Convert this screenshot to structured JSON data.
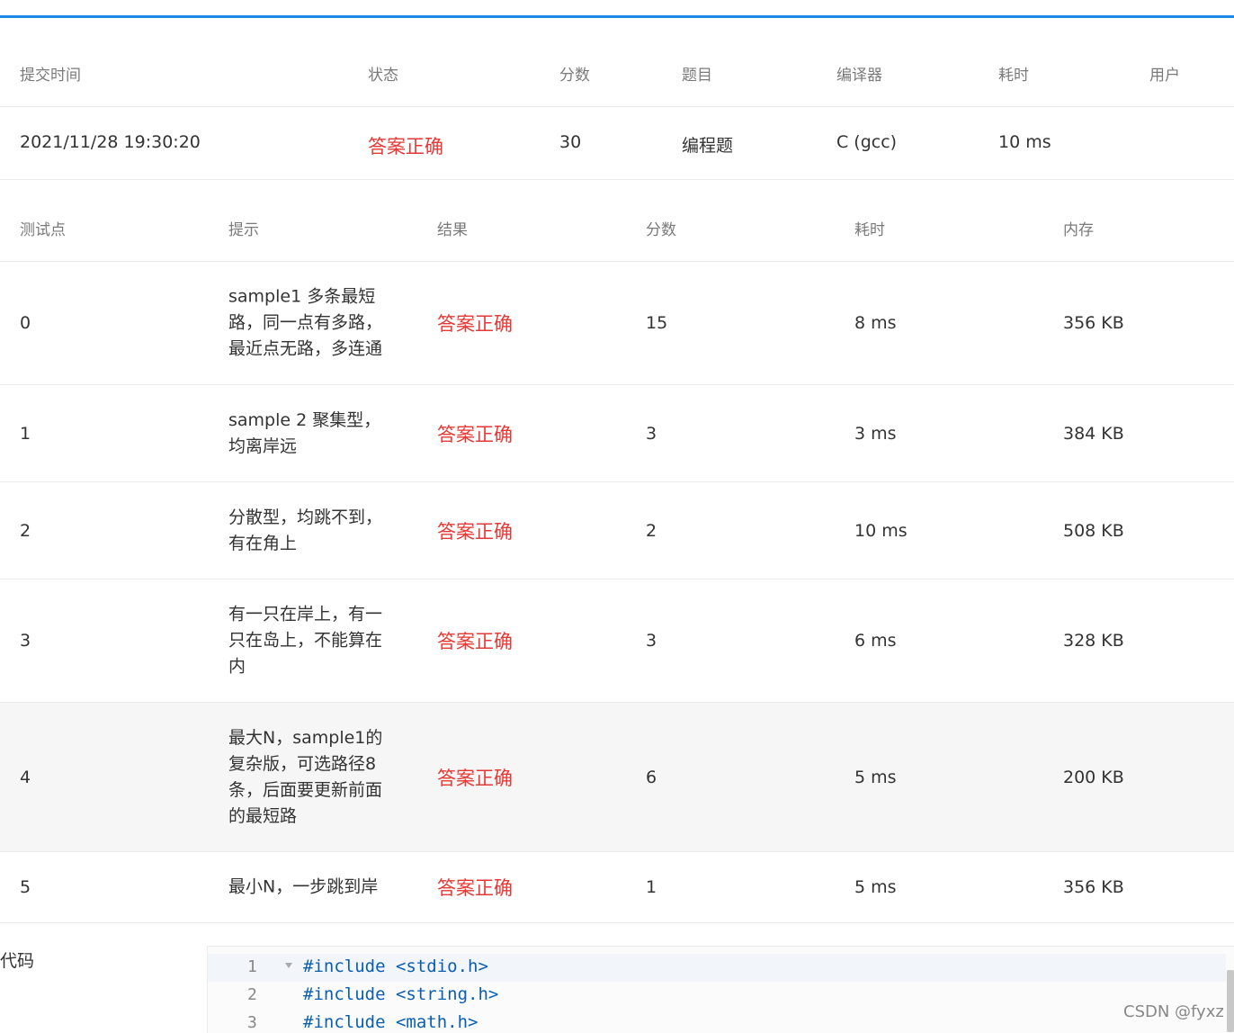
{
  "submission": {
    "headers": [
      "提交时间",
      "状态",
      "分数",
      "题目",
      "编译器",
      "耗时",
      "用户"
    ],
    "row": {
      "time": "2021/11/28 19:30:20",
      "status": "答案正确",
      "score": "30",
      "problem": "编程题",
      "compiler": "C (gcc)",
      "elapsed": "10 ms",
      "user": ""
    }
  },
  "cases": {
    "headers": [
      "测试点",
      "提示",
      "结果",
      "分数",
      "耗时",
      "内存"
    ],
    "rows": [
      {
        "id": "0",
        "hint": "sample1 多条最短路，同一点有多路，最近点无路，多连通",
        "result": "答案正确",
        "score": "15",
        "time": "8 ms",
        "memory": "356 KB"
      },
      {
        "id": "1",
        "hint": "sample 2 聚集型，均离岸远",
        "result": "答案正确",
        "score": "3",
        "time": "3 ms",
        "memory": "384 KB"
      },
      {
        "id": "2",
        "hint": "分散型，均跳不到，有在角上",
        "result": "答案正确",
        "score": "2",
        "time": "10 ms",
        "memory": "508 KB"
      },
      {
        "id": "3",
        "hint": "有一只在岸上，有一只在岛上，不能算在内",
        "result": "答案正确",
        "score": "3",
        "time": "6 ms",
        "memory": "328 KB"
      },
      {
        "id": "4",
        "hint": "最大N，sample1的复杂版，可选路径8条，后面要更新前面的最短路",
        "result": "答案正确",
        "score": "6",
        "time": "5 ms",
        "memory": "200 KB"
      },
      {
        "id": "5",
        "hint": "最小N，一步跳到岸",
        "result": "答案正确",
        "score": "1",
        "time": "5 ms",
        "memory": "356 KB"
      }
    ]
  },
  "code": {
    "label": "代码",
    "lines": [
      {
        "n": "1",
        "text": "#include <stdio.h>"
      },
      {
        "n": "2",
        "text": "#include <string.h>"
      },
      {
        "n": "3",
        "text": "#include <math.h>"
      }
    ]
  },
  "watermark": "CSDN @fyxz",
  "colors": {
    "accent": "#1e88e5",
    "success": "#e53935"
  }
}
